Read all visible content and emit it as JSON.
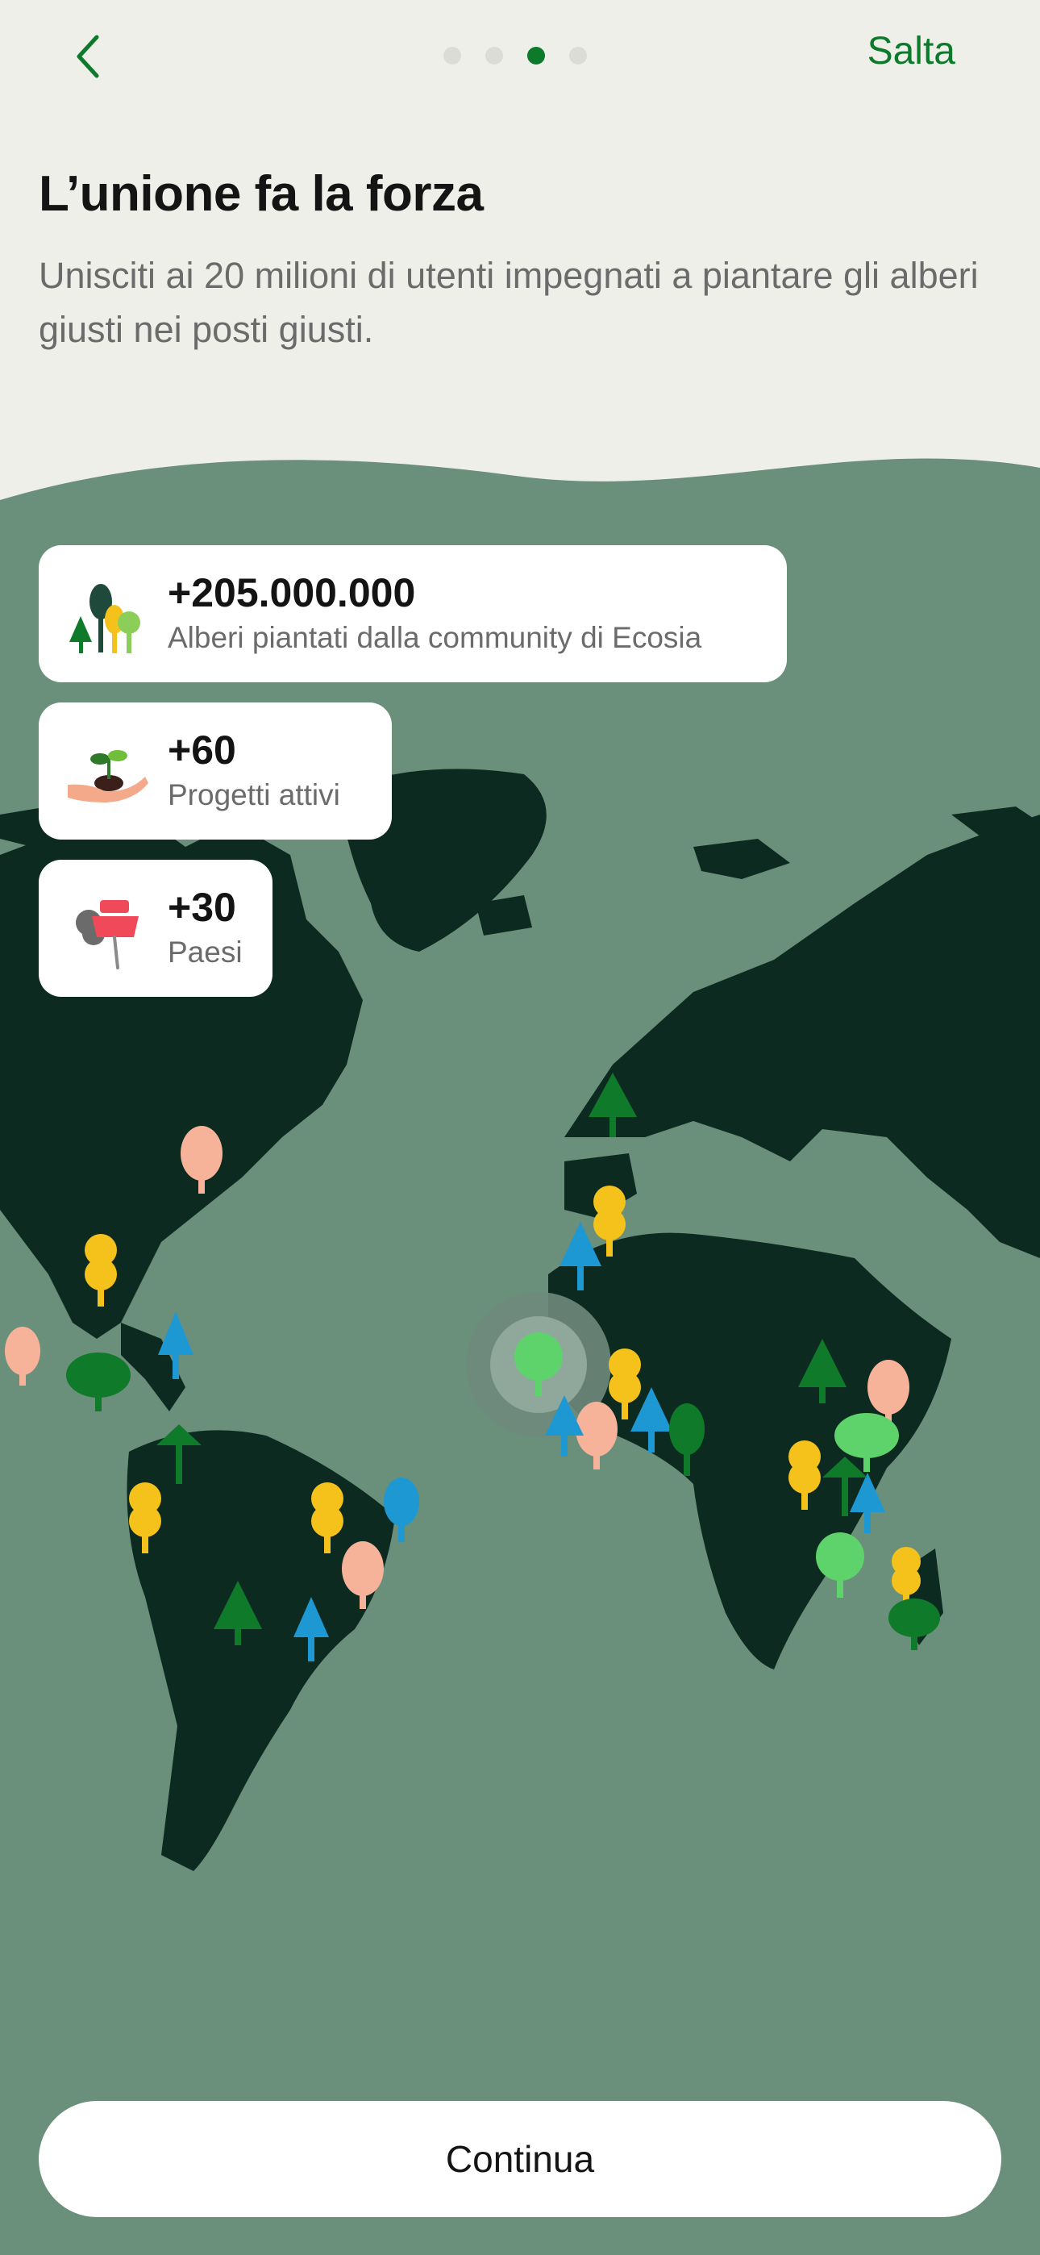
{
  "nav": {
    "back_icon": "chevron-left-icon",
    "skip_label": "Salta",
    "pages_total": 4,
    "current_page": 3
  },
  "header": {
    "title": "L’unione fa la forza",
    "subtitle": "Unisciti ai 20 milioni di utenti impegnati a piantare gli alberi giusti nei posti giusti."
  },
  "stats": [
    {
      "value": "+205.000.000",
      "label": "Alberi piantati dalla community di Ecosia",
      "icon": "trees-icon"
    },
    {
      "value": "+60",
      "label": "Progetti attivi",
      "icon": "seedling-hand-icon"
    },
    {
      "value": "+30",
      "label": "Paesi",
      "icon": "pushpin-icon"
    }
  ],
  "map": {
    "icon": "world-map",
    "markers_icon": "tree-marker-icon"
  },
  "colors": {
    "accent": "#0c7a2a",
    "top_bg": "#efefea",
    "map_bg": "#6a8f7b",
    "land": "#0c2a1f",
    "tree_yellow": "#f5c21b",
    "tree_blue": "#1e98d3",
    "tree_green": "#0f7a2a",
    "tree_light_green": "#5fd36b",
    "tree_peach": "#f6b39a"
  },
  "actions": {
    "continue_label": "Continua"
  }
}
